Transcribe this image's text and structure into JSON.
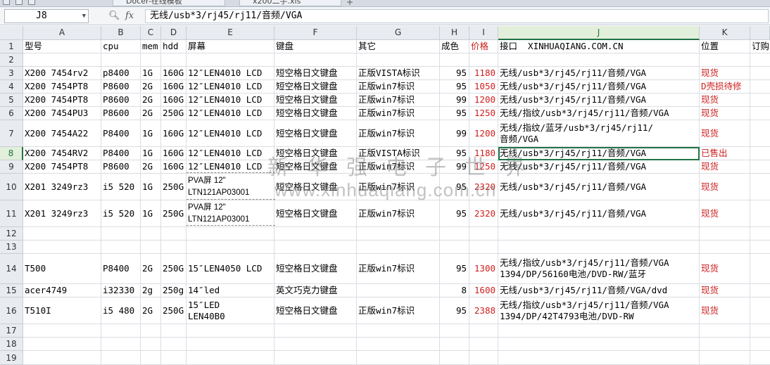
{
  "tabs": [
    {
      "label": "Docer-在线模板"
    },
    {
      "label": "x200二手.xls"
    }
  ],
  "formula_bar": {
    "cell_ref": "J8",
    "fx_label": "fx",
    "content": "无线/usb*3/rj45/rj11/音频/VGA"
  },
  "columns": [
    "A",
    "B",
    "C",
    "D",
    "E",
    "F",
    "G",
    "H",
    "I",
    "J",
    "K"
  ],
  "row_numbers": [
    "1",
    "2",
    "3",
    "4",
    "5",
    "6",
    "7",
    "8",
    "9",
    "10",
    "11",
    "12",
    "13",
    "14",
    "15",
    "16",
    "17",
    "18",
    "19"
  ],
  "cells": {
    "r1": {
      "A": "型号",
      "B": "cpu",
      "C": "mem",
      "D": "hdd",
      "E": "屏幕",
      "F": "键盘",
      "G": "其它",
      "H": "成色",
      "I": "价格",
      "J": "接口  XINHUAQIANG.COM.CN",
      "K": "位置",
      "L": "订购"
    },
    "r3": {
      "A": "X200 7454rv2",
      "B": "p8400",
      "C": "1G",
      "D": "160G",
      "E": "12″LEN4010 LCD",
      "F": "短空格日文键盘",
      "G": "正版VISTA标识",
      "H": "95",
      "I": "1180",
      "J": "无线/usb*3/rj45/rj11/音频/VGA",
      "K": "现货"
    },
    "r4": {
      "A": "X200 7454PT8",
      "B": "P8600",
      "C": "2G",
      "D": "160G",
      "E": "12″LEN4010 LCD",
      "F": "短空格日文键盘",
      "G": "正版win7标识",
      "H": "95",
      "I": "1050",
      "J": "无线/usb*3/rj45/rj11/音频/VGA",
      "K": "D壳损待修"
    },
    "r5": {
      "A": "X200 7454PT8",
      "B": "P8600",
      "C": "2G",
      "D": "160G",
      "E": "12″LEN4010 LCD",
      "F": "短空格日文键盘",
      "G": "正版win7标识",
      "H": "99",
      "I": "1200",
      "J": "无线/usb*3/rj45/rj11/音频/VGA",
      "K": "现货"
    },
    "r6": {
      "A": "X200 7454PU3",
      "B": "P8600",
      "C": "2G",
      "D": "250G",
      "E": "12″LEN4010 LCD",
      "F": "短空格日文键盘",
      "G": "正版win7标识",
      "H": "95",
      "I": "1250",
      "J": "无线/指纹/usb*3/rj45/rj11/音频/VGA",
      "K": "现货"
    },
    "r7": {
      "A": "X200 7454A22",
      "B": "P8400",
      "C": "1G",
      "D": "160G",
      "E": "12″LEN4010 LCD",
      "F": "短空格日文键盘",
      "G": "正版win7标识",
      "H": "99",
      "I": "1200",
      "J": "无线/指纹/蓝牙/usb*3/rj45/rj11/\n音频/VGA",
      "K": "现货"
    },
    "r8": {
      "A": "X200 7454RV2",
      "B": "P8400",
      "C": "1G",
      "D": "160G",
      "E": "12″LEN4010 LCD",
      "F": "短空格日文键盘",
      "G": "正版VISTA标识",
      "H": "95",
      "I": "1180",
      "J": "无线/usb*3/rj45/rj11/音频/VGA",
      "K": "已售出"
    },
    "r9": {
      "A": "X200 7454PT8",
      "B": "P8600",
      "C": "2G",
      "D": "160G",
      "E": "12″LEN4010 LCD",
      "F": "短空格日文键盘",
      "G": "正版win7标识",
      "H": "99",
      "I": "1250",
      "J": "无线/usb*3/rj45/rj11/音频/VGA",
      "K": "现货"
    },
    "r10": {
      "A": "X201 3249rz3",
      "B": "i5 520",
      "C": "1G",
      "D": "250G",
      "E": "PVA屏 12\"\nLTN121AP03001",
      "F": "短空格日文键盘",
      "G": "正版win7标识",
      "H": "95",
      "I": "2320",
      "J": "无线/usb*3/rj45/rj11/音频/VGA",
      "K": "现货"
    },
    "r11": {
      "A": "X201 3249rz3",
      "B": "i5 520",
      "C": "1G",
      "D": "250G",
      "E": "PVA屏 12\"\nLTN121AP03001",
      "F": "短空格日文键盘",
      "G": "正版win7标识",
      "H": "95",
      "I": "2320",
      "J": "无线/usb*3/rj45/rj11/音频/VGA",
      "K": "现货"
    },
    "r14": {
      "A": "T500",
      "B": "P8400",
      "C": "2G",
      "D": "250G",
      "E": "15″LEN4050 LCD",
      "F": "短空格日文键盘",
      "G": "正版win7标识",
      "H": "95",
      "I": "1300",
      "J": "无线/指纹/usb*3/rj45/rj11/音频/VGA\n1394/DP/56160电池/DVD-RW/蓝牙",
      "K": "现货"
    },
    "r15": {
      "A": "acer4749",
      "B": "i32330",
      "C": "2g",
      "D": "250g",
      "E": "14″led",
      "F": "英文巧克力键盘",
      "G": "",
      "H": "8",
      "I": "1600",
      "J": "无线/usb*3/rj45/rj11/音频/VGA/dvd",
      "K": "现货"
    },
    "r16": {
      "A": "T510I",
      "B": "i5 480",
      "C": "2G",
      "D": "250G",
      "E": "15″LED\nLEN40B0",
      "F": "短空格日文键盘",
      "G": "正版win7标识",
      "H": "95",
      "I": "2388",
      "J": "无线/指纹/usb*3/rj45/rj11/音频/VGA\n1394/DP/42T4793电池/DVD-RW",
      "K": "现货"
    }
  },
  "watermark": {
    "line1": "新华强电子世界",
    "line2": "www.xinhuaqiang.com.cn"
  },
  "colors": {
    "price_red": "#cc1f1f",
    "selection_green": "#217346",
    "header_bg": "#e8ebef"
  }
}
